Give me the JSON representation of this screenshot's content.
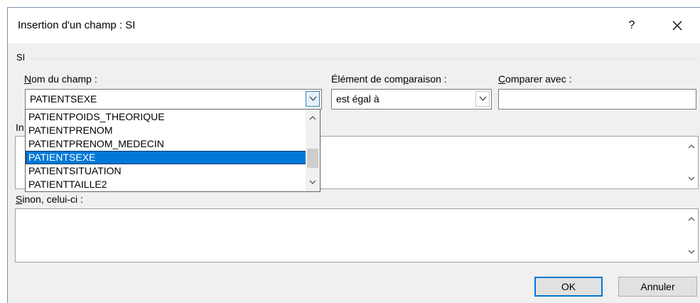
{
  "dialog": {
    "title": "Insertion d'un champ : SI",
    "help_label": "?",
    "close_label": "✕",
    "group_label": "SI"
  },
  "field_name": {
    "label_accel": "N",
    "label_rest": "om du champ :",
    "selected_value": "PATIENTSEXE",
    "options": [
      "PATIENTPOIDS_THEORIQUE",
      "PATIENTPRENOM",
      "PATIENTPRENOM_MEDECIN",
      "PATIENTSEXE",
      "PATIENTSITUATION",
      "PATIENTTAILLE2"
    ],
    "highlighted_index": 3
  },
  "comparison": {
    "label_pre": "Élément de com",
    "label_accel": "p",
    "label_post": "araison :",
    "value": "est égal à"
  },
  "compare_with": {
    "label_accel": "C",
    "label_rest": "omparer avec :",
    "value": ""
  },
  "insert_text": {
    "label_visible": "In"
  },
  "else_text": {
    "label_accel": "S",
    "label_rest": "inon, celui-ci :"
  },
  "buttons": {
    "ok": "OK",
    "cancel": "Annuler"
  }
}
